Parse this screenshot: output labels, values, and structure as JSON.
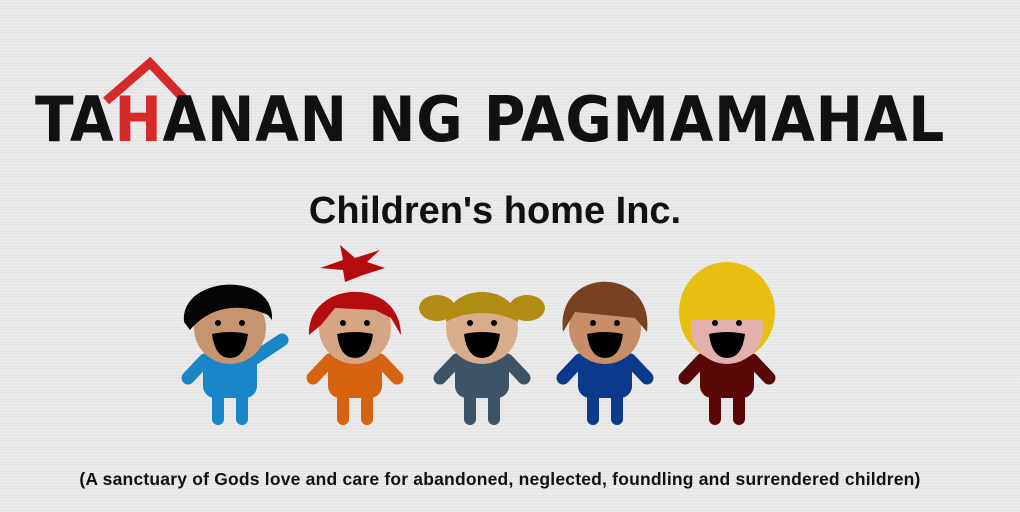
{
  "title": {
    "before": "TA",
    "highlight": "H",
    "after": "ANAN NG PAGMAMAHAL",
    "highlight_color": "#d42a2a"
  },
  "subtitle": "Children's home Inc.",
  "tagline": "(A sanctuary of Gods love and care for abandoned, neglected, foundling and surrendered children)",
  "icons": {
    "roof": "house-roof-icon"
  },
  "kids": [
    {
      "hair": "short-black",
      "hair_color": "#050505",
      "skin": "#c79470",
      "shirt": "#1a86c8",
      "pose": "waving"
    },
    {
      "hair": "spiky-red",
      "hair_color": "#b50d0d",
      "skin": "#d5a584",
      "shirt": "#d7620f",
      "pose": "standing"
    },
    {
      "hair": "pigtails",
      "hair_color": "#b18c14",
      "skin": "#d9ad8c",
      "shirt": "#3e5366",
      "pose": "standing"
    },
    {
      "hair": "bowl-brown",
      "hair_color": "#784220",
      "skin": "#c88e68",
      "shirt": "#0b3a8d",
      "pose": "standing"
    },
    {
      "hair": "long-blonde",
      "hair_color": "#e9be12",
      "skin": "#e3aeae",
      "shirt": "#5a0707",
      "pose": "standing"
    }
  ]
}
